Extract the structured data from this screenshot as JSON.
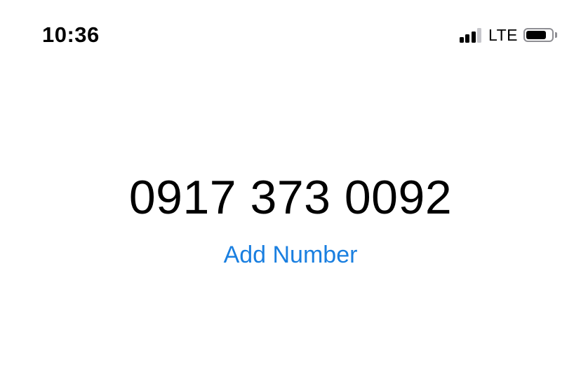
{
  "status_bar": {
    "time": "10:36",
    "network_type": "LTE",
    "signal_bars_active": 3,
    "signal_bars_total": 4,
    "battery_level_percent": 80,
    "icons": {
      "signal": "cellular-signal-icon",
      "battery": "battery-icon"
    }
  },
  "dialer": {
    "number": "0917 373 0092",
    "add_number_label": "Add Number"
  },
  "colors": {
    "text": "#000000",
    "link": "#1a7fe0",
    "signal_inactive": "#c7c7cc",
    "battery_outline": "#8e8e93",
    "background": "#ffffff"
  }
}
